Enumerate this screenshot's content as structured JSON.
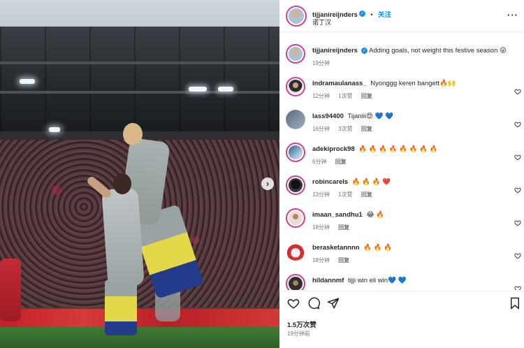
{
  "header": {
    "username": "tijjanireijnders",
    "follow_label": "关注",
    "subtitle": "诺丁汉",
    "more_icon": "more-horizontal-icon"
  },
  "caption": {
    "username": "tijjanireijnders",
    "text": "Adding goals, not weight this festive season 😜",
    "time": "19分钟"
  },
  "comments": [
    {
      "username": "indramaulanass_",
      "text": "Nyonggg keren bangett🔥🙌",
      "time": "12分钟",
      "likes": "1次赞",
      "reply": "回复"
    },
    {
      "username": "lass94400",
      "text": "Tijaniii😍 💙 💙",
      "time": "16分钟",
      "likes": "3次赞",
      "reply": "回复"
    },
    {
      "username": "adekiprock98",
      "text": "🔥 🔥 🔥 🔥 🔥 🔥 🔥 🔥",
      "time": "6分钟",
      "likes": "",
      "reply": "回复"
    },
    {
      "username": "robincarels",
      "text": "🔥 🔥 🔥 ❤️",
      "time": "13分钟",
      "likes": "1次赞",
      "reply": "回复"
    },
    {
      "username": "imaan_sandhu1",
      "text": "😂 🔥",
      "time": "18分钟",
      "likes": "",
      "reply": "回复"
    },
    {
      "username": "berasketannnn",
      "text": "🔥 🔥 🔥",
      "time": "18分钟",
      "likes": "",
      "reply": "回复"
    },
    {
      "username": "hildannmf",
      "text": "tijji win eli win💙 💙",
      "time": "",
      "likes": "",
      "reply": ""
    }
  ],
  "actions": {
    "likes": "1.5万次赞",
    "time": "19分钟前"
  },
  "colors": {
    "accent": "#0095f6",
    "story_ring": "#d93a8f",
    "verified": "#1a8cf0"
  }
}
